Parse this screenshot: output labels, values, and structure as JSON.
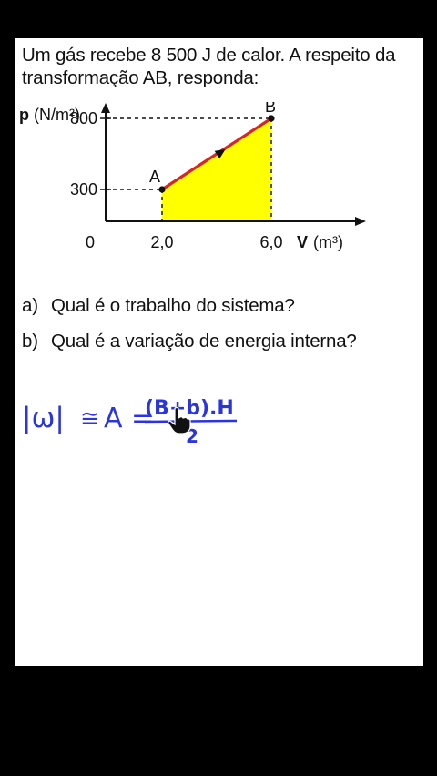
{
  "problem": {
    "line1": "Um gás recebe 8 500 J de calor. A respeito da",
    "line2": "transformação AB, responda:"
  },
  "graph": {
    "y_axis_label_bold": "p",
    "y_axis_unit": "(N/m²)",
    "x_axis_label_bold": "V",
    "x_axis_unit": "(m³)",
    "origin_label": "0",
    "y_ticks": [
      "800",
      "300"
    ],
    "x_ticks": [
      "2,0",
      "6,0"
    ],
    "point_a": "A",
    "point_b": "B",
    "fill_color": "#ffff00",
    "line_color": "#d7262a"
  },
  "chart_data": {
    "type": "line",
    "xlabel": "V (m³)",
    "ylabel": "p (N/m²)",
    "series": [
      {
        "name": "AB",
        "x": [
          2.0,
          6.0
        ],
        "y": [
          300,
          800
        ]
      }
    ],
    "point_labels": [
      "A",
      "B"
    ],
    "shaded_area_under_curve": true,
    "grid": false
  },
  "questions": [
    {
      "letter": "a)",
      "text": "Qual é o trabalho do sistema?"
    },
    {
      "letter": "b)",
      "text": "Qual é a variação de energia interna?"
    }
  ],
  "handwriting": {
    "text": "|W| ≅ A = (B+b).H / 2",
    "lhs": "|ω|",
    "approx": "≅",
    "area": "A =",
    "numerator": "(B+b).H",
    "denominator": "2",
    "ink_color": "#2a35e0"
  },
  "icons": {
    "pointer": "hand-pointer-icon"
  }
}
